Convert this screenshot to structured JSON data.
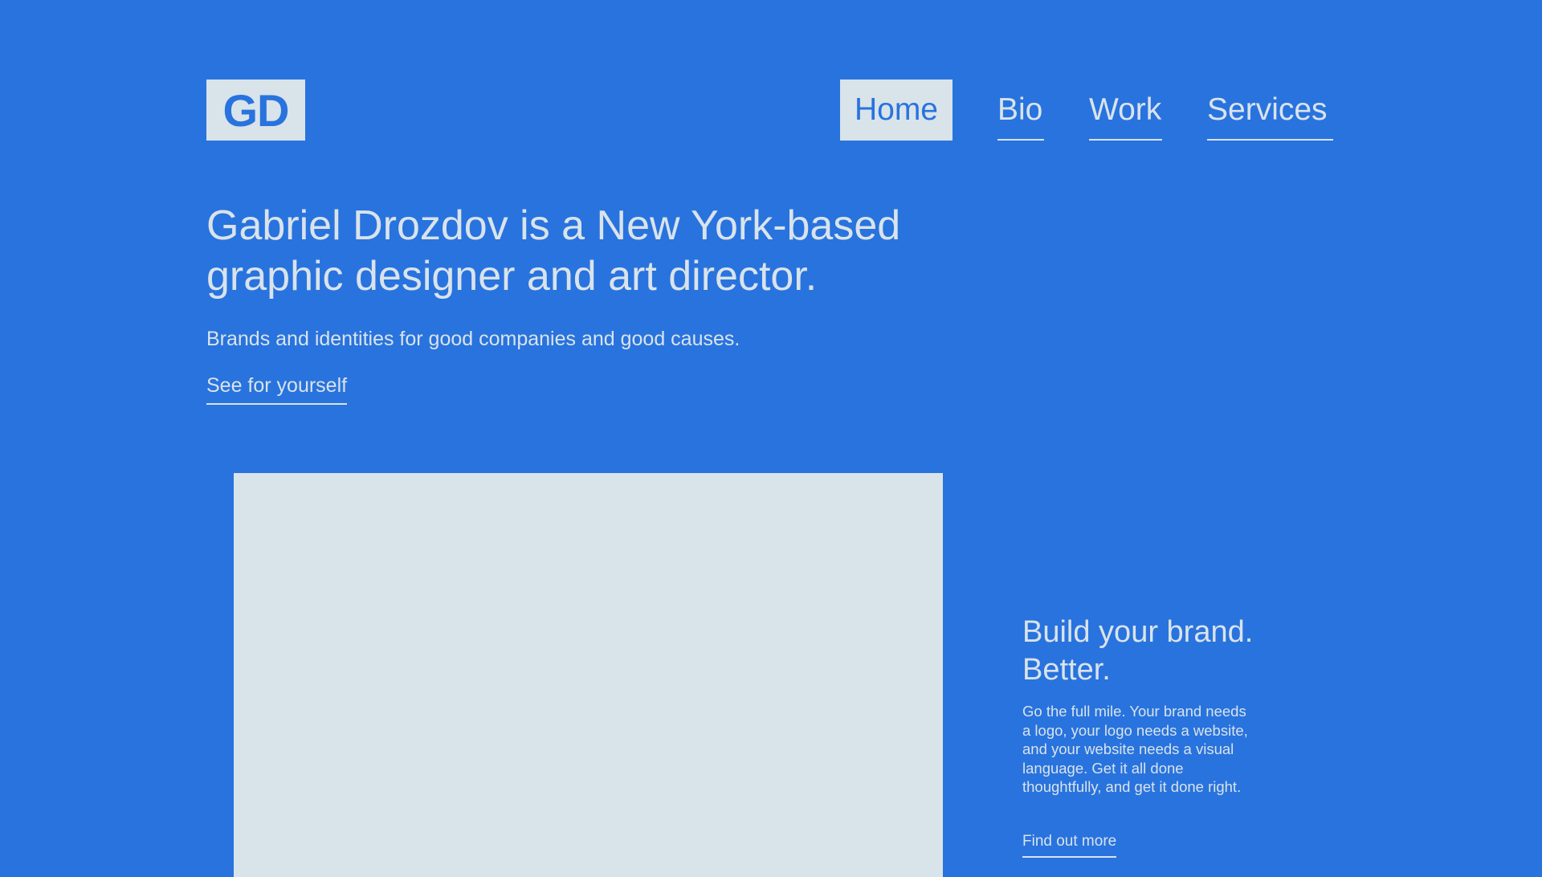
{
  "header": {
    "logo_text": "GD",
    "nav": [
      {
        "label": "Home",
        "active": true
      },
      {
        "label": "Bio",
        "active": false
      },
      {
        "label": "Work",
        "active": false
      },
      {
        "label": "Services",
        "active": false
      }
    ]
  },
  "hero": {
    "title": "Gabriel Drozdov is a New York-based graphic designer and art director.",
    "subtitle": "Brands and identities for good companies and good causes.",
    "link_label": "See for yourself"
  },
  "promo": {
    "title": "Build your brand. Better.",
    "text": "Go the full mile. Your brand needs a logo, your logo needs a website, and your website needs a visual language. Get it all done thoughtfully, and get it done right.",
    "link_label": "Find out more"
  },
  "colors": {
    "background": "#2873de",
    "foreground": "#d9e3ea"
  }
}
